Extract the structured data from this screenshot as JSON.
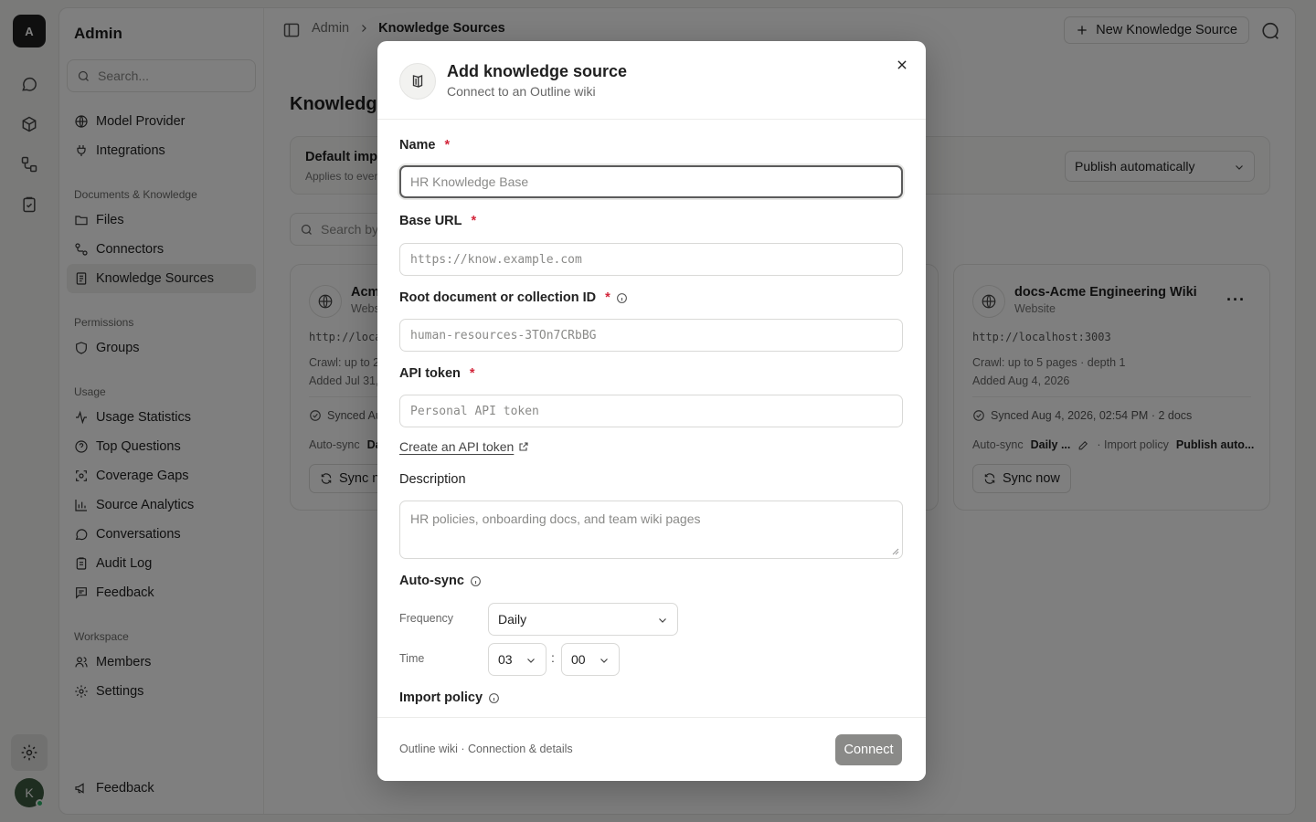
{
  "rail": {
    "logo_letter": "A",
    "avatar_letter": "K"
  },
  "sidebar": {
    "title": "Admin",
    "search_placeholder": "Search...",
    "items_top": [
      {
        "label": "Model Provider",
        "icon": "globe-icon"
      },
      {
        "label": "Integrations",
        "icon": "plug-icon"
      }
    ],
    "sections": [
      {
        "title": "Documents & Knowledge",
        "items": [
          {
            "label": "Files",
            "icon": "folder-icon"
          },
          {
            "label": "Connectors",
            "icon": "connector-icon"
          },
          {
            "label": "Knowledge Sources",
            "icon": "book-icon",
            "active": true
          }
        ]
      },
      {
        "title": "Permissions",
        "items": [
          {
            "label": "Groups",
            "icon": "shield-icon"
          }
        ]
      },
      {
        "title": "Usage",
        "items": [
          {
            "label": "Usage Statistics",
            "icon": "activity-icon"
          },
          {
            "label": "Top Questions",
            "icon": "question-icon"
          },
          {
            "label": "Coverage Gaps",
            "icon": "scan-icon"
          },
          {
            "label": "Source Analytics",
            "icon": "bar-chart-icon"
          },
          {
            "label": "Conversations",
            "icon": "chat-icon"
          },
          {
            "label": "Audit Log",
            "icon": "clipboard-icon"
          },
          {
            "label": "Feedback",
            "icon": "message-icon"
          }
        ]
      },
      {
        "title": "Workspace",
        "items": [
          {
            "label": "Members",
            "icon": "users-icon"
          },
          {
            "label": "Settings",
            "icon": "gear-icon"
          }
        ]
      }
    ],
    "footer_feedback": "Feedback"
  },
  "topbar": {
    "breadcrumb_root": "Admin",
    "breadcrumb_current": "Knowledge Sources",
    "new_button": "New Knowledge Source"
  },
  "page": {
    "heading": "Knowledge",
    "policy_title": "Default impo",
    "policy_sub": "Applies to ever",
    "policy_select": "Publish automatically",
    "search_placeholder": "Search by"
  },
  "cards": [
    {
      "name": "Acm",
      "type": "Webs",
      "url": "http://local",
      "crawl": "Crawl: up to 2",
      "added": "Added Jul 31,",
      "synced": "Synced Au",
      "autosync_label": "Auto-sync",
      "autosync_value": "Da",
      "sync_button": "Sync n"
    },
    {
      "name": "docs-Acme Engineering Wiki",
      "type": "Website",
      "url": "http://localhost:3003",
      "crawl": "Crawl: up to 5 pages · depth 1",
      "added": "Added Aug 4, 2026",
      "synced": "Synced Aug 4, 2026, 02:54 PM · 2 docs",
      "autosync_label": "Auto-sync",
      "autosync_value": "Daily ...",
      "import_label": "· Import policy",
      "import_value": "Publish auto...",
      "sync_button": "Sync now"
    }
  ],
  "modal": {
    "title": "Add knowledge source",
    "subtitle": "Connect to an Outline wiki",
    "name_label": "Name",
    "name_placeholder": "HR Knowledge Base",
    "base_url_label": "Base URL",
    "base_url_placeholder": "https://know.example.com",
    "root_label": "Root document or collection ID",
    "root_placeholder": "human-resources-3TOn7CRbBG",
    "token_label": "API token",
    "token_placeholder": "Personal API token",
    "token_link": "Create an API token",
    "description_label": "Description",
    "description_placeholder": "HR policies, onboarding docs, and team wiki pages",
    "autosync_label": "Auto-sync",
    "frequency_label": "Frequency",
    "frequency_value": "Daily",
    "time_label": "Time",
    "time_hour": "03",
    "time_separator": ":",
    "time_minute": "00",
    "import_label": "Import policy",
    "required_mark": "*",
    "footer_text": "Outline wiki · Connection & details",
    "connect_button": "Connect"
  }
}
